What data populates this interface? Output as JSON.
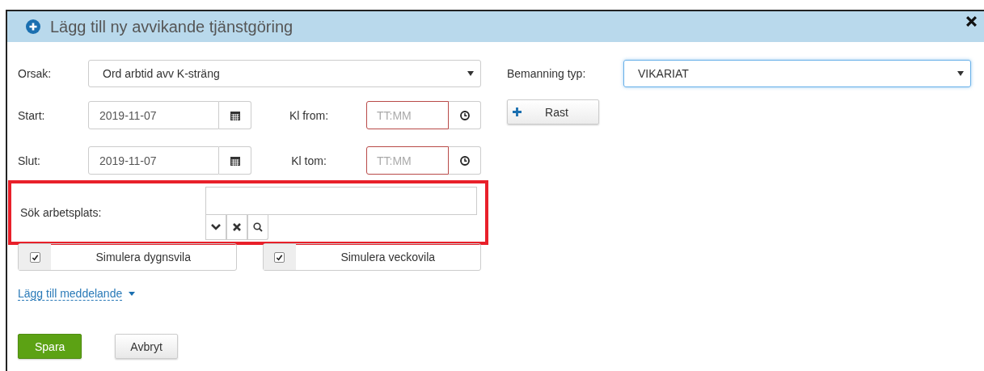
{
  "dialog": {
    "title": "Lägg till ny avvikande tjänstgöring"
  },
  "orsak": {
    "label": "Orsak:",
    "value": "Ord arbtid avv K-sträng"
  },
  "start": {
    "label": "Start:",
    "value": "2019-11-07"
  },
  "kl_from": {
    "label": "Kl from:",
    "placeholder": "TT:MM",
    "invalid": true
  },
  "slut": {
    "label": "Slut:",
    "value": "2019-11-07"
  },
  "kl_tom": {
    "label": "Kl tom:",
    "placeholder": "TT:MM",
    "invalid": true
  },
  "bemanning_typ": {
    "label": "Bemanning typ:",
    "value": "VIKARIAT",
    "focused": true
  },
  "rast_button": {
    "label": "Rast"
  },
  "search": {
    "label": "Sök arbetsplats:",
    "highlighted": true
  },
  "toggles": [
    {
      "label": "Simulera dygnsvila",
      "checked": true
    },
    {
      "label": "Simulera veckovila",
      "checked": true
    }
  ],
  "message_link": {
    "label": "Lägg till meddelande"
  },
  "buttons": [
    {
      "label": "Spara",
      "kind": "primary"
    },
    {
      "label": "Avbryt",
      "kind": "default"
    }
  ]
}
